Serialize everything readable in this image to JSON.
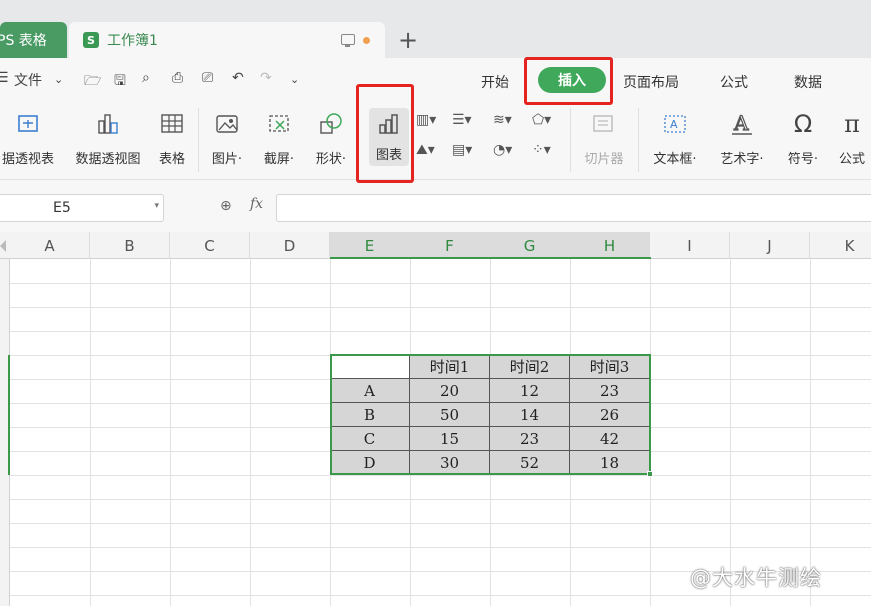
{
  "titlebar": {
    "wps_tab": "PS 表格",
    "book_tab": "工作簿1",
    "new_tab": "+"
  },
  "menubar": {
    "file": "文件",
    "tabs": [
      "开始",
      "插入",
      "页面布局",
      "公式",
      "数据"
    ]
  },
  "ribbon": {
    "items": [
      "据透视表",
      "数据透视图",
      "表格",
      "图片·",
      "截屏·",
      "形状·",
      "图表",
      "切片器",
      "文本框·",
      "艺术字·",
      "符号·",
      "公式"
    ]
  },
  "formula_bar": {
    "name_box": "E5",
    "fx": "fx",
    "value": ""
  },
  "sheet": {
    "columns": [
      "A",
      "B",
      "C",
      "D",
      "E",
      "F",
      "G",
      "H",
      "I",
      "J",
      "K"
    ],
    "selected_columns": [
      "E",
      "F",
      "G",
      "H"
    ],
    "table": {
      "header": [
        "",
        "时间1",
        "时间2",
        "时间3"
      ],
      "rows": [
        [
          "A",
          "20",
          "12",
          "23"
        ],
        [
          "B",
          "50",
          "14",
          "26"
        ],
        [
          "C",
          "15",
          "23",
          "42"
        ],
        [
          "D",
          "30",
          "52",
          "18"
        ]
      ]
    }
  },
  "colors": {
    "accent": "#3fa85a",
    "selection": "#3a9a4a",
    "highlight": "#e52420",
    "cell_fill": "#d6d6d6"
  },
  "watermark": "@大水牛测绘"
}
